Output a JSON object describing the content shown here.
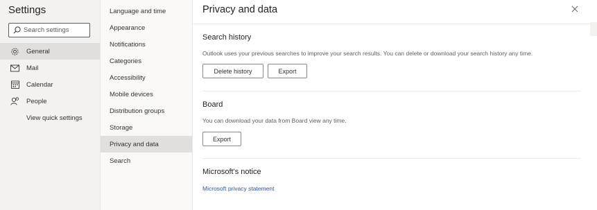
{
  "left_pane": {
    "title": "Settings",
    "search_placeholder": "Search settings",
    "items": [
      {
        "label": "General",
        "icon": "gear-icon",
        "selected": true
      },
      {
        "label": "Mail",
        "icon": "mail-icon",
        "selected": false
      },
      {
        "label": "Calendar",
        "icon": "calendar-icon",
        "selected": false
      },
      {
        "label": "People",
        "icon": "people-icon",
        "selected": false
      }
    ],
    "view_quick_settings": "View quick settings"
  },
  "sub_nav": {
    "items": [
      {
        "label": "Language and time",
        "selected": false
      },
      {
        "label": "Appearance",
        "selected": false
      },
      {
        "label": "Notifications",
        "selected": false
      },
      {
        "label": "Categories",
        "selected": false
      },
      {
        "label": "Accessibility",
        "selected": false
      },
      {
        "label": "Mobile devices",
        "selected": false
      },
      {
        "label": "Distribution groups",
        "selected": false
      },
      {
        "label": "Storage",
        "selected": false
      },
      {
        "label": "Privacy and data",
        "selected": true
      },
      {
        "label": "Search",
        "selected": false
      }
    ]
  },
  "main": {
    "title": "Privacy and data",
    "close_icon": "close-icon",
    "search_history": {
      "title": "Search history",
      "description": "Outlook uses your previous searches to improve your search results. You can delete or download your search history any time.",
      "delete_label": "Delete history",
      "export_label": "Export"
    },
    "board": {
      "title": "Board",
      "description": "You can download your data from Board view any time.",
      "export_label": "Export"
    },
    "notice": {
      "title": "Microsoft's notice",
      "link": "Microsoft privacy statement"
    }
  },
  "colors": {
    "link": "#2b579a",
    "selected_bg": "#e1dfdd",
    "left_pane_bg": "#f3f2f1"
  }
}
